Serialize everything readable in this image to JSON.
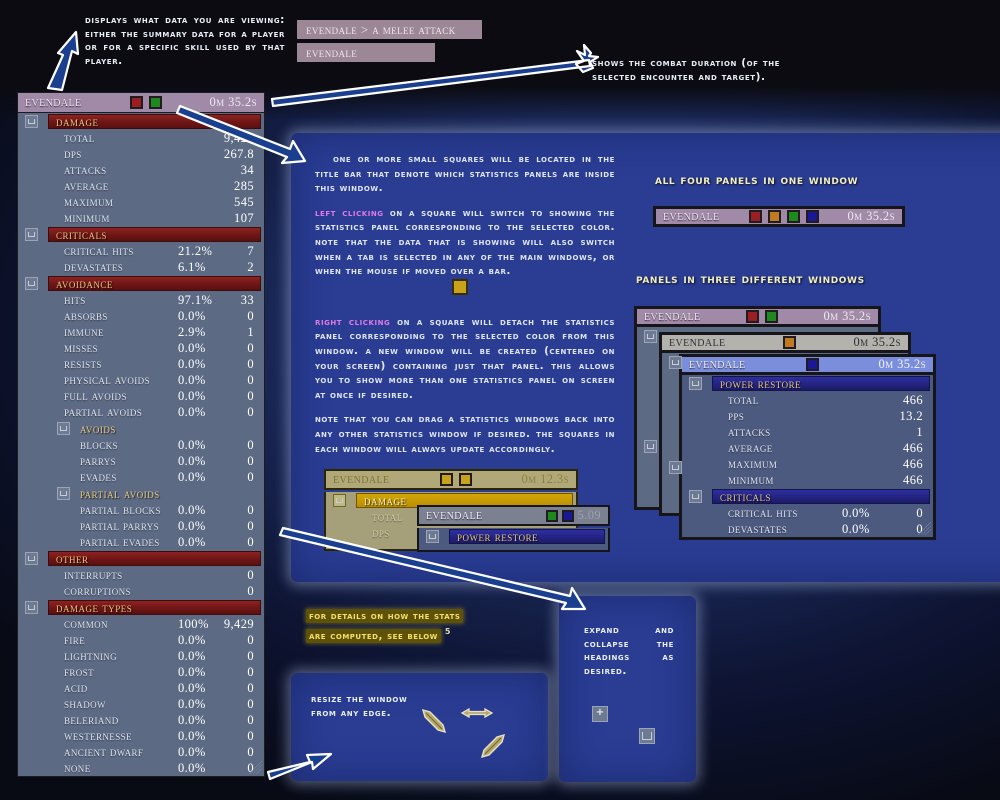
{
  "annotations": {
    "top_left": "Displays what data you are viewing: either the summary data for a player or for a specific skill used by that player.",
    "top_right": "Shows the combat duration (of the selected encounter and target).",
    "resize": "Resize the window from any edge.",
    "expand": "Expand and Collapse the headings as desired.",
    "stats_note_line1": "For details on how the stats",
    "stats_note_line2": "are computed, see below",
    "stats_note_sup": "5"
  },
  "breadcrumbs": [
    {
      "label": "Evendale > a melee attack"
    },
    {
      "label": "Evendale"
    }
  ],
  "info_panel": {
    "para1": "One or more small squares will be located in the title bar that denote which statistics panels are inside this window.",
    "para2_lead": "Left clicking",
    "para2": " on a square will switch to showing the statistics panel corresponding to the selected color. Note that the data that is showing will also switch when a tab is selected in any of the main windows, or when the mouse if moved over a bar.",
    "para3_lead": "Right clicking",
    "para3": " on a square will detach the statistics panel corresponding to the selected color from this window. A new window will be created (centered on your screen) containing just that panel. This allows you to show more than one statistics panel on screen at once if desired.",
    "para4": "Note that you can drag a statistics windows back into any other statistics window if desired. The squares in each window will always update accordingly.",
    "heading_all_four": "All four panels in one window",
    "heading_three": "Panels in three different windows"
  },
  "colors": {
    "square_red": "#9b1f22",
    "square_green": "#1e8a1e",
    "square_orange": "#c07a20",
    "square_blue": "#191996",
    "square_gold": "#c9a21c",
    "titlebar_purple": "#a08aa8",
    "titlebar_grey": "#b4b2ac",
    "titlebar_blue": "#7b8edc",
    "titlebar_olive": "#b0a878",
    "titlebar_slate": "#7b8190",
    "header_red": "#6e1616",
    "header_blue": "#23237f",
    "header_gold": "#b98e04",
    "panel_body": "#5c6a84",
    "heading_text": "#e8c77e",
    "accent_pink": "#e07ae8",
    "accent_yellow": "#f3eec0"
  },
  "main_window": {
    "title": "Evendale",
    "time": "0m 35.2s",
    "squares": [
      "square_red",
      "square_green"
    ],
    "sections": [
      {
        "heading": "Damage",
        "style": "red",
        "indent": 0,
        "rows": [
          {
            "label": "Total",
            "pct": "",
            "value": "9,429"
          },
          {
            "label": "DPS",
            "pct": "",
            "value": "267.8"
          },
          {
            "label": "Attacks",
            "pct": "",
            "value": "34"
          },
          {
            "label": "Average",
            "pct": "",
            "value": "285"
          },
          {
            "label": "Maximum",
            "pct": "",
            "value": "545"
          },
          {
            "label": "Minimum",
            "pct": "",
            "value": "107"
          }
        ]
      },
      {
        "heading": "Criticals",
        "style": "red",
        "indent": 0,
        "rows": [
          {
            "label": "Critical Hits",
            "pct": "21.2%",
            "value": "7"
          },
          {
            "label": "Devastates",
            "pct": "6.1%",
            "value": "2"
          }
        ]
      },
      {
        "heading": "Avoidance",
        "style": "red",
        "indent": 0,
        "rows": [
          {
            "label": "Hits",
            "pct": "97.1%",
            "value": "33"
          },
          {
            "label": "Absorbs",
            "pct": "0.0%",
            "value": "0"
          },
          {
            "label": "Immune",
            "pct": "2.9%",
            "value": "1"
          },
          {
            "label": "Misses",
            "pct": "0.0%",
            "value": "0"
          },
          {
            "label": "Resists",
            "pct": "0.0%",
            "value": "0"
          },
          {
            "label": "Physical Avoids",
            "pct": "0.0%",
            "value": "0"
          },
          {
            "label": "Full Avoids",
            "pct": "0.0%",
            "value": "0"
          },
          {
            "label": "Partial Avoids",
            "pct": "0.0%",
            "value": "0"
          }
        ]
      },
      {
        "heading": "Avoids",
        "style": "plain",
        "indent": 1,
        "rows": [
          {
            "label": "Blocks",
            "pct": "0.0%",
            "value": "0"
          },
          {
            "label": "Parrys",
            "pct": "0.0%",
            "value": "0"
          },
          {
            "label": "Evades",
            "pct": "0.0%",
            "value": "0"
          }
        ]
      },
      {
        "heading": "Partial Avoids",
        "style": "plain",
        "indent": 1,
        "rows": [
          {
            "label": "Partial Blocks",
            "pct": "0.0%",
            "value": "0"
          },
          {
            "label": "Partial Parrys",
            "pct": "0.0%",
            "value": "0"
          },
          {
            "label": "Partial Evades",
            "pct": "0.0%",
            "value": "0"
          }
        ]
      },
      {
        "heading": "Other",
        "style": "red",
        "indent": 0,
        "rows": [
          {
            "label": "Interrupts",
            "pct": "",
            "value": "0"
          },
          {
            "label": "Corruptions",
            "pct": "",
            "value": "0"
          }
        ]
      },
      {
        "heading": "Damage Types",
        "style": "red",
        "indent": 0,
        "rows": [
          {
            "label": "Common",
            "pct": "100%",
            "value": "9,429"
          },
          {
            "label": "Fire",
            "pct": "0.0%",
            "value": "0"
          },
          {
            "label": "Lightning",
            "pct": "0.0%",
            "value": "0"
          },
          {
            "label": "Frost",
            "pct": "0.0%",
            "value": "0"
          },
          {
            "label": "Acid",
            "pct": "0.0%",
            "value": "0"
          },
          {
            "label": "Shadow",
            "pct": "0.0%",
            "value": "0"
          },
          {
            "label": "Beleriand",
            "pct": "0.0%",
            "value": "0"
          },
          {
            "label": "Westernesse",
            "pct": "0.0%",
            "value": "0"
          },
          {
            "label": "Ancient Dwarf",
            "pct": "0.0%",
            "value": "0"
          },
          {
            "label": "None",
            "pct": "0.0%",
            "value": "0"
          }
        ]
      }
    ]
  },
  "all_four_window": {
    "title": "Evendale",
    "time": "0m 35.2s",
    "squares": [
      "square_red",
      "square_orange",
      "square_green",
      "square_blue"
    ]
  },
  "three_windows": {
    "back": {
      "title": "Evendale",
      "time": "0m 35.2s",
      "squares": [
        "square_red",
        "square_green"
      ]
    },
    "mid": {
      "title": "Evendale",
      "time": "0m 35.2s",
      "squares": [
        "square_orange"
      ]
    },
    "front": {
      "title": "Evendale",
      "time": "0m 35.2s",
      "squares": [
        "square_blue"
      ],
      "sections": [
        {
          "heading": "Power Restore",
          "style": "blue",
          "indent": 0,
          "rows": [
            {
              "label": "Total",
              "pct": "",
              "value": "466"
            },
            {
              "label": "PPS",
              "pct": "",
              "value": "13.2"
            },
            {
              "label": "Attacks",
              "pct": "",
              "value": "1"
            },
            {
              "label": "Average",
              "pct": "",
              "value": "466"
            },
            {
              "label": "Maximum",
              "pct": "",
              "value": "466"
            },
            {
              "label": "Minimum",
              "pct": "",
              "value": "466"
            }
          ]
        },
        {
          "heading": "Criticals",
          "style": "blue",
          "indent": 0,
          "rows": [
            {
              "label": "Critical Hits",
              "pct": "0.0%",
              "value": "0"
            },
            {
              "label": "Devastates",
              "pct": "0.0%",
              "value": "0"
            }
          ]
        }
      ]
    }
  },
  "drag_demo": {
    "olive_window": {
      "title": "Evendale",
      "time": "0m 12.3s",
      "squares": [
        "square_gold",
        "square_gold"
      ],
      "heading": "Damage",
      "rows": [
        {
          "label": "Total",
          "value": ""
        },
        {
          "label": "DPS",
          "value": ""
        }
      ]
    },
    "grey_window": {
      "title": "Evendale",
      "time": "5.09",
      "squares": [
        "square_green",
        "square_blue"
      ],
      "heading": "Power Restore"
    }
  },
  "icons": {
    "collapse": "collapse-icon",
    "expand": "expand-icon",
    "resize_diag": "resize-diagonal-cursor",
    "resize_horiz": "resize-horizontal-cursor"
  }
}
